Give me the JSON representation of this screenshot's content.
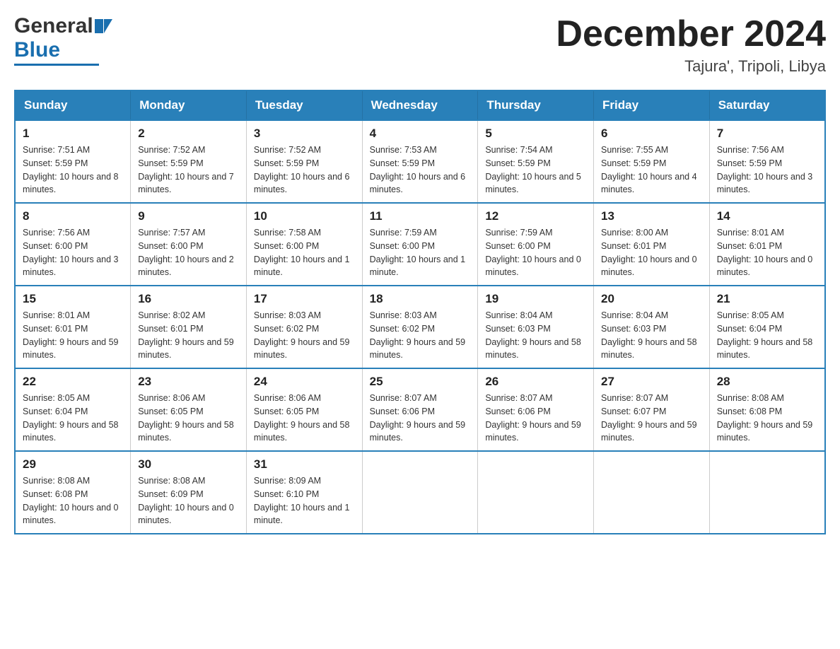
{
  "header": {
    "logo_general": "General",
    "logo_blue": "Blue",
    "month": "December 2024",
    "location": "Tajura', Tripoli, Libya"
  },
  "days": [
    "Sunday",
    "Monday",
    "Tuesday",
    "Wednesday",
    "Thursday",
    "Friday",
    "Saturday"
  ],
  "weeks": [
    [
      {
        "day": "1",
        "sunrise": "7:51 AM",
        "sunset": "5:59 PM",
        "daylight": "10 hours and 8 minutes."
      },
      {
        "day": "2",
        "sunrise": "7:52 AM",
        "sunset": "5:59 PM",
        "daylight": "10 hours and 7 minutes."
      },
      {
        "day": "3",
        "sunrise": "7:52 AM",
        "sunset": "5:59 PM",
        "daylight": "10 hours and 6 minutes."
      },
      {
        "day": "4",
        "sunrise": "7:53 AM",
        "sunset": "5:59 PM",
        "daylight": "10 hours and 6 minutes."
      },
      {
        "day": "5",
        "sunrise": "7:54 AM",
        "sunset": "5:59 PM",
        "daylight": "10 hours and 5 minutes."
      },
      {
        "day": "6",
        "sunrise": "7:55 AM",
        "sunset": "5:59 PM",
        "daylight": "10 hours and 4 minutes."
      },
      {
        "day": "7",
        "sunrise": "7:56 AM",
        "sunset": "5:59 PM",
        "daylight": "10 hours and 3 minutes."
      }
    ],
    [
      {
        "day": "8",
        "sunrise": "7:56 AM",
        "sunset": "6:00 PM",
        "daylight": "10 hours and 3 minutes."
      },
      {
        "day": "9",
        "sunrise": "7:57 AM",
        "sunset": "6:00 PM",
        "daylight": "10 hours and 2 minutes."
      },
      {
        "day": "10",
        "sunrise": "7:58 AM",
        "sunset": "6:00 PM",
        "daylight": "10 hours and 1 minute."
      },
      {
        "day": "11",
        "sunrise": "7:59 AM",
        "sunset": "6:00 PM",
        "daylight": "10 hours and 1 minute."
      },
      {
        "day": "12",
        "sunrise": "7:59 AM",
        "sunset": "6:00 PM",
        "daylight": "10 hours and 0 minutes."
      },
      {
        "day": "13",
        "sunrise": "8:00 AM",
        "sunset": "6:01 PM",
        "daylight": "10 hours and 0 minutes."
      },
      {
        "day": "14",
        "sunrise": "8:01 AM",
        "sunset": "6:01 PM",
        "daylight": "10 hours and 0 minutes."
      }
    ],
    [
      {
        "day": "15",
        "sunrise": "8:01 AM",
        "sunset": "6:01 PM",
        "daylight": "9 hours and 59 minutes."
      },
      {
        "day": "16",
        "sunrise": "8:02 AM",
        "sunset": "6:01 PM",
        "daylight": "9 hours and 59 minutes."
      },
      {
        "day": "17",
        "sunrise": "8:03 AM",
        "sunset": "6:02 PM",
        "daylight": "9 hours and 59 minutes."
      },
      {
        "day": "18",
        "sunrise": "8:03 AM",
        "sunset": "6:02 PM",
        "daylight": "9 hours and 59 minutes."
      },
      {
        "day": "19",
        "sunrise": "8:04 AM",
        "sunset": "6:03 PM",
        "daylight": "9 hours and 58 minutes."
      },
      {
        "day": "20",
        "sunrise": "8:04 AM",
        "sunset": "6:03 PM",
        "daylight": "9 hours and 58 minutes."
      },
      {
        "day": "21",
        "sunrise": "8:05 AM",
        "sunset": "6:04 PM",
        "daylight": "9 hours and 58 minutes."
      }
    ],
    [
      {
        "day": "22",
        "sunrise": "8:05 AM",
        "sunset": "6:04 PM",
        "daylight": "9 hours and 58 minutes."
      },
      {
        "day": "23",
        "sunrise": "8:06 AM",
        "sunset": "6:05 PM",
        "daylight": "9 hours and 58 minutes."
      },
      {
        "day": "24",
        "sunrise": "8:06 AM",
        "sunset": "6:05 PM",
        "daylight": "9 hours and 58 minutes."
      },
      {
        "day": "25",
        "sunrise": "8:07 AM",
        "sunset": "6:06 PM",
        "daylight": "9 hours and 59 minutes."
      },
      {
        "day": "26",
        "sunrise": "8:07 AM",
        "sunset": "6:06 PM",
        "daylight": "9 hours and 59 minutes."
      },
      {
        "day": "27",
        "sunrise": "8:07 AM",
        "sunset": "6:07 PM",
        "daylight": "9 hours and 59 minutes."
      },
      {
        "day": "28",
        "sunrise": "8:08 AM",
        "sunset": "6:08 PM",
        "daylight": "9 hours and 59 minutes."
      }
    ],
    [
      {
        "day": "29",
        "sunrise": "8:08 AM",
        "sunset": "6:08 PM",
        "daylight": "10 hours and 0 minutes."
      },
      {
        "day": "30",
        "sunrise": "8:08 AM",
        "sunset": "6:09 PM",
        "daylight": "10 hours and 0 minutes."
      },
      {
        "day": "31",
        "sunrise": "8:09 AM",
        "sunset": "6:10 PM",
        "daylight": "10 hours and 1 minute."
      },
      null,
      null,
      null,
      null
    ]
  ]
}
